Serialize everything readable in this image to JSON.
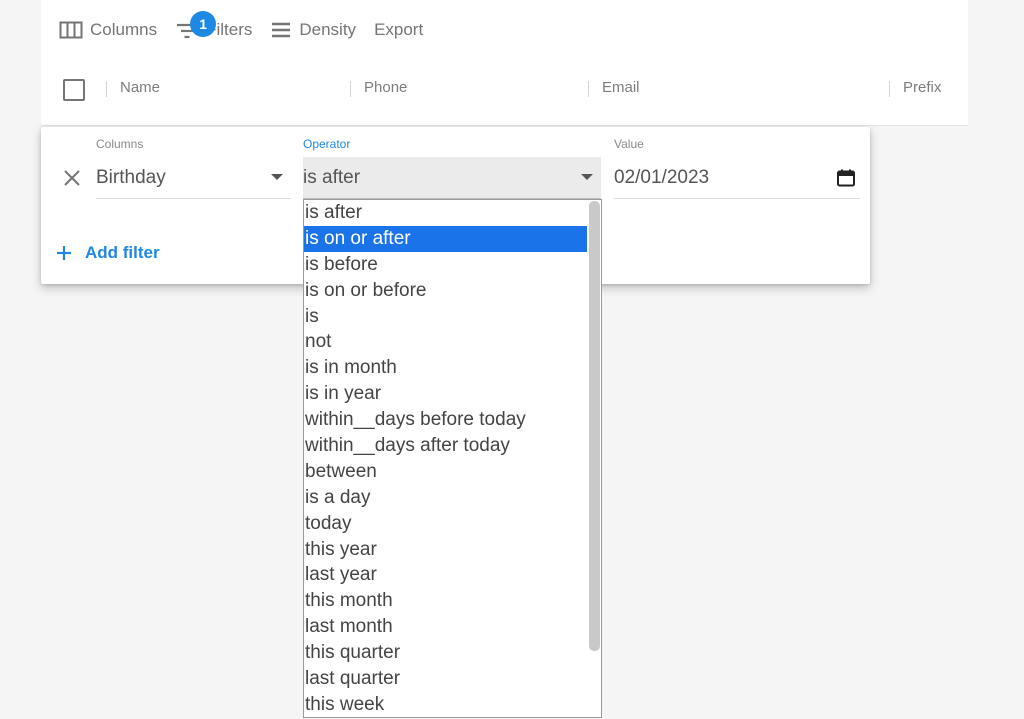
{
  "toolbar": {
    "columns_label": "Columns",
    "filters_label": "Filters",
    "filters_badge": "1",
    "density_label": "Density",
    "export_label": "Export"
  },
  "grid": {
    "headers": [
      "Name",
      "Phone",
      "Email",
      "Prefix"
    ]
  },
  "filter": {
    "columns_label": "Columns",
    "columns_value": "Birthday",
    "operator_label": "Operator",
    "operator_value": "is after",
    "value_label": "Value",
    "value_value": "02/01/2023",
    "add_filter_label": "Add filter"
  },
  "operator_options": [
    "is after",
    "is on or after",
    "is before",
    "is on or before",
    "is",
    "not",
    "is in month",
    "is in year",
    "within__days before today",
    "within__days after today",
    "between",
    "is a day",
    "today",
    "this year",
    "last year",
    "this month",
    "last month",
    "this quarter",
    "last quarter",
    "this week"
  ],
  "highlighted_option_index": 1,
  "colors": {
    "accent": "#1e88e5",
    "selection": "#1a73e8",
    "badge": "#1e88e5"
  }
}
